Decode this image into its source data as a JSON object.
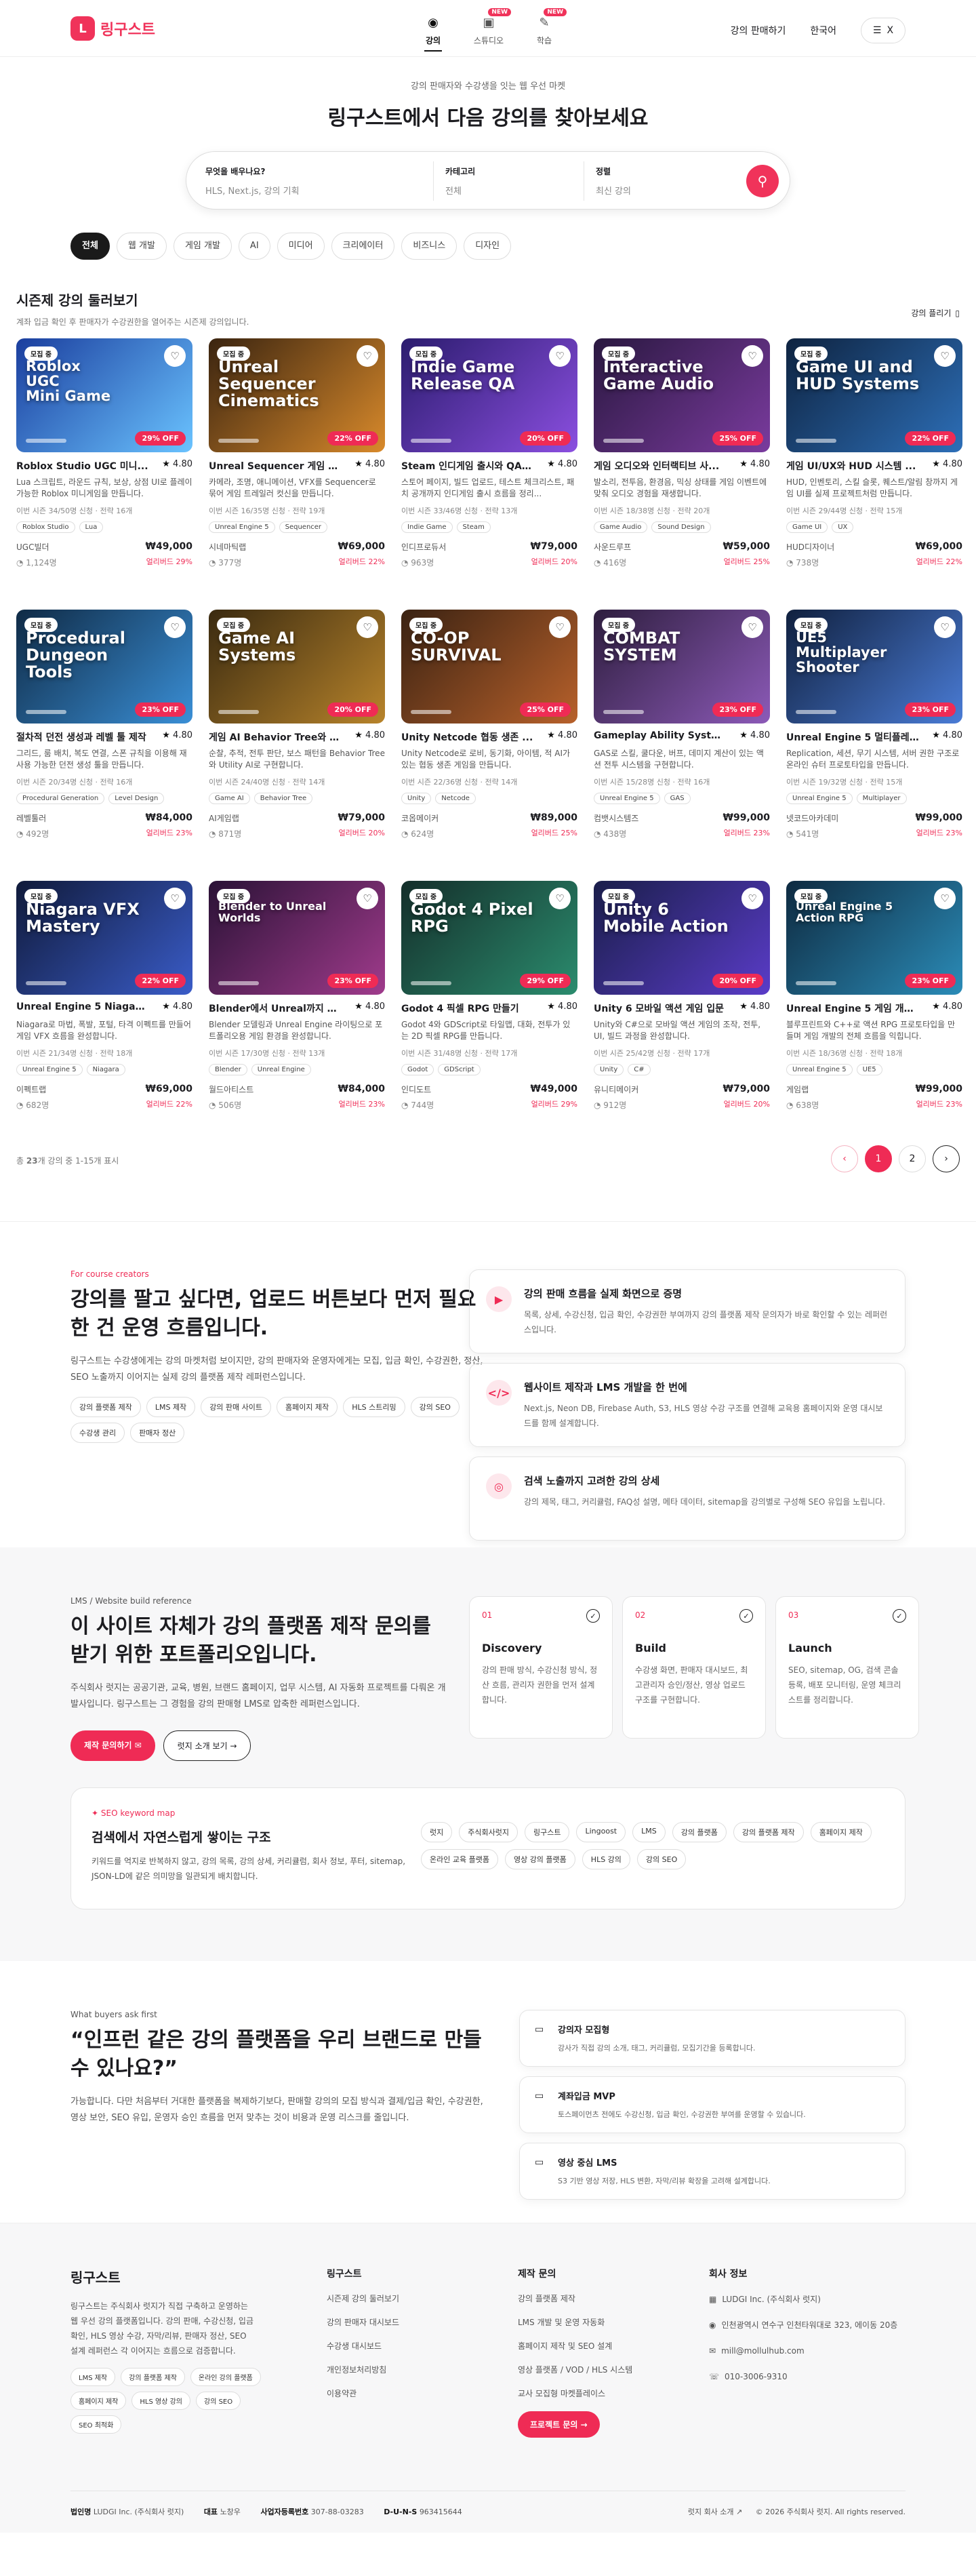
{
  "header": {
    "logo_mark": "L",
    "logo_text": "링구스트",
    "nav": [
      {
        "label": "강의",
        "icon": "play-circle-icon",
        "glyph": "▶",
        "badge": ""
      },
      {
        "label": "스튜디오",
        "icon": "studio-icon",
        "glyph": "◫",
        "badge": "NEW"
      },
      {
        "label": "학습",
        "icon": "learn-icon",
        "glyph": "✎",
        "badge": "NEW"
      }
    ],
    "sell_link": "강의 판매하기",
    "language": "한국어",
    "menu_icon": "☰",
    "menu_x": "X"
  },
  "hero": {
    "subtitle": "강의 판매자와 수강생을 잇는 웹 우선 마켓",
    "title": "링구스트에서 다음 강의를 찾아보세요",
    "search": {
      "q_label": "무엇을 배우나요?",
      "q_placeholder": "HLS, Next.js, 강의 기획",
      "cat_label": "카테고리",
      "cat_value": "전체",
      "sort_label": "정렬",
      "sort_value": "최신 강의"
    }
  },
  "categories": [
    "전체",
    "웹 개발",
    "게임 개발",
    "AI",
    "미디어",
    "크리에이터",
    "비즈니스",
    "디자인"
  ],
  "list": {
    "title": "시즌제 강의 둘러보기",
    "subtitle": "계좌 입금 확인 후 판매자가 수강권한을 열어주는 시즌제 강의입니다.",
    "toggle": "강의 플리기"
  },
  "courses": [
    {
      "thumb": "Roblox\nUGC\nMini Game",
      "colors": [
        "#1b3e9e",
        "#6ac3ff"
      ],
      "open": "모집 중",
      "off": "29% OFF",
      "title": "Roblox Studio UGC 미니...",
      "rating": "4.80",
      "desc": "Lua 스크립트, 라운드 규칙, 보상, 상점 UI로 플레이 가능한 Roblox 미니게임을 만듭니다.",
      "meta": "이번 시즌 34/50명 신청 · 전략 16개",
      "tags": [
        "Roblox Studio",
        "Lua"
      ],
      "author": "UGC빌더",
      "count": "1,124명",
      "price": "₩49,000",
      "early": "얼리버드 29%"
    },
    {
      "thumb": "Unreal Sequencer\nCinematics",
      "colors": [
        "#3a2410",
        "#d98a2b"
      ],
      "open": "모집 중",
      "off": "22% OFF",
      "title": "Unreal Sequencer 게임 시...",
      "rating": "4.80",
      "desc": "카메라, 조명, 애니메이션, VFX를 Sequencer로 묶어 게임 트레일러 컷신을 만듭니다.",
      "meta": "이번 시즌 16/35명 신청 · 전략 19개",
      "tags": [
        "Unreal Engine 5",
        "Sequencer"
      ],
      "author": "시네마틱랩",
      "count": "377명",
      "price": "₩69,000",
      "early": "얼리버드 22%"
    },
    {
      "thumb": "Indie Game\nRelease QA",
      "colors": [
        "#2b1c6e",
        "#8b4fe0"
      ],
      "open": "모집 중",
      "off": "20% OFF",
      "title": "Steam 인디게임 출시와 QA ...",
      "rating": "4.80",
      "desc": "스토어 페이지, 빌드 업로드, 테스트 체크리스트, 패치 공개까지 인디게임 출시 흐름을 정리...",
      "meta": "이번 시즌 33/46명 신청 · 전략 13개",
      "tags": [
        "Indie Game",
        "Steam"
      ],
      "author": "인디프로듀서",
      "count": "963명",
      "price": "₩79,000",
      "early": "얼리버드 20%"
    },
    {
      "thumb": "Interactive\nGame Audio",
      "colors": [
        "#2a1840",
        "#7a3b9e"
      ],
      "open": "모집 중",
      "off": "25% OFF",
      "title": "게임 오디오와 인터랙티브 사...",
      "rating": "4.80",
      "desc": "발소리, 전투음, 환경음, 믹싱 상태를 게임 이벤트에 맞춰 오디오 경험을 재생합니다.",
      "meta": "이번 시즌 18/38명 신청 · 전략 20개",
      "tags": [
        "Game Audio",
        "Sound Design"
      ],
      "author": "사운드루프",
      "count": "416명",
      "price": "₩59,000",
      "early": "얼리버드 25%"
    },
    {
      "thumb": "Game UI and\nHUD Systems",
      "colors": [
        "#0e2340",
        "#2d6fb8"
      ],
      "open": "모집 중",
      "off": "22% OFF",
      "title": "게임 UI/UX와 HUD 시스템 ...",
      "rating": "4.80",
      "desc": "HUD, 인벤토리, 스킬 슬롯, 퀘스트/알림 창까지 게임 UI를 실제 프로젝트처럼 만듭니다.",
      "meta": "이번 시즌 29/44명 신청 · 전략 15개",
      "tags": [
        "Game UI",
        "UX"
      ],
      "author": "HUD디자이너",
      "count": "738명",
      "price": "₩69,000",
      "early": "얼리버드 22%"
    },
    {
      "thumb": "Procedural\nDungeon Tools",
      "colors": [
        "#0f2a45",
        "#3a8fd6"
      ],
      "open": "모집 중",
      "off": "23% OFF",
      "title": "절차적 던전 생성과 레벨 툴 제작",
      "rating": "4.80",
      "desc": "그리드, 룸 배치, 복도 연결, 스폰 규칙을 이용해 재사용 가능한 던전 생성 툴을 만듭니다.",
      "meta": "이번 시즌 20/34명 신청 · 전략 16개",
      "tags": [
        "Procedural Generation",
        "Level Design"
      ],
      "author": "레벨툴러",
      "count": "492명",
      "price": "₩84,000",
      "early": "얼리버드 23%"
    },
    {
      "thumb": "Game AI\nSystems",
      "colors": [
        "#3a2a10",
        "#b8842b"
      ],
      "open": "모집 중",
      "off": "20% OFF",
      "title": "게임 AI Behavior Tree와 U...",
      "rating": "4.80",
      "desc": "순찰, 추적, 전투 판단, 보스 패턴을 Behavior Tree와 Utility AI로 구현합니다.",
      "meta": "이번 시즌 24/40명 신청 · 전략 14개",
      "tags": [
        "Game AI",
        "Behavior Tree"
      ],
      "author": "AI게임랩",
      "count": "871명",
      "price": "₩79,000",
      "early": "얼리버드 20%"
    },
    {
      "thumb": "CO-OP\nSURVIVAL",
      "colors": [
        "#3a2212",
        "#b8612b"
      ],
      "open": "모집 중",
      "off": "25% OFF",
      "title": "Unity Netcode 협동 생존 ...",
      "rating": "4.80",
      "desc": "Unity Netcode로 로비, 동기화, 아이템, 적 AI가 있는 협동 생존 게임을 만듭니다.",
      "meta": "이번 시즌 22/36명 신청 · 전략 14개",
      "tags": [
        "Unity",
        "Netcode"
      ],
      "author": "코옵메이커",
      "count": "624명",
      "price": "₩89,000",
      "early": "얼리버드 25%"
    },
    {
      "thumb": "COMBAT\nSYSTEM",
      "colors": [
        "#2e1e3e",
        "#8c5ab8"
      ],
      "open": "모집 중",
      "off": "23% OFF",
      "title": "Gameplay Ability Syste...",
      "rating": "4.80",
      "desc": "GAS로 스킬, 쿨다운, 버프, 데미지 계산이 있는 액션 전투 시스템을 구현합니다.",
      "meta": "이번 시즌 15/28명 신청 · 전략 16개",
      "tags": [
        "Unreal Engine 5",
        "GAS"
      ],
      "author": "컴뱃시스템즈",
      "count": "438명",
      "price": "₩99,000",
      "early": "얼리버드 23%"
    },
    {
      "thumb": "UE5\nMultiplayer\nShooter",
      "colors": [
        "#10203e",
        "#4a7cd6"
      ],
      "open": "모집 중",
      "off": "23% OFF",
      "title": "Unreal Engine 5 멀티플레...",
      "rating": "4.80",
      "desc": "Replication, 세션, 무기 시스템, 서버 권한 구조로 온라인 슈터 프로토타입을 만듭니다.",
      "meta": "이번 시즌 19/32명 신청 · 전략 15개",
      "tags": [
        "Unreal Engine 5",
        "Multiplayer"
      ],
      "author": "넷코드아카데미",
      "count": "541명",
      "price": "₩99,000",
      "early": "얼리버드 23%"
    },
    {
      "thumb": "Niagara VFX Mastery",
      "colors": [
        "#101a3a",
        "#3a5cc8"
      ],
      "open": "모집 중",
      "off": "22% OFF",
      "title": "Unreal Engine 5 Niagara...",
      "rating": "4.80",
      "desc": "Niagara로 마법, 폭발, 포털, 타격 이펙트를 만들어 게임 VFX 흐름을 완성합니다.",
      "meta": "이번 시즌 21/34명 신청 · 전략 18개",
      "tags": [
        "Unreal Engine 5",
        "Niagara"
      ],
      "author": "이펙트랩",
      "count": "682명",
      "price": "₩69,000",
      "early": "얼리버드 22%"
    },
    {
      "thumb": "Blender to Unreal Worlds",
      "colors": [
        "#2a1236",
        "#a03b8c"
      ],
      "open": "모집 중",
      "off": "23% OFF",
      "title": "Blender에서 Unreal까지 게...",
      "rating": "4.80",
      "desc": "Blender 모델링과 Unreal Engine 라이팅으로 포트폴리오용 게임 환경을 완성합니다.",
      "meta": "이번 시즌 17/30명 신청 · 전략 13개",
      "tags": [
        "Blender",
        "Unreal Engine"
      ],
      "author": "월드아티스트",
      "count": "506명",
      "price": "₩84,000",
      "early": "얼리버드 23%"
    },
    {
      "thumb": "Godot 4 Pixel RPG",
      "colors": [
        "#142e2a",
        "#2b8c6e"
      ],
      "open": "모집 중",
      "off": "29% OFF",
      "title": "Godot 4 픽셀 RPG 만들기",
      "rating": "4.80",
      "desc": "Godot 4와 GDScript로 타일맵, 대화, 전투가 있는 2D 픽셀 RPG를 만듭니다.",
      "meta": "이번 시즌 31/48명 신청 · 전략 17개",
      "tags": [
        "Godot",
        "GDScript"
      ],
      "author": "인디도트",
      "count": "744명",
      "price": "₩49,000",
      "early": "얼리버드 29%"
    },
    {
      "thumb": "Unity 6 Mobile Action",
      "colors": [
        "#1a1e4a",
        "#5a3cc8"
      ],
      "open": "모집 중",
      "off": "20% OFF",
      "title": "Unity 6 모바일 액션 게임 입문",
      "rating": "4.80",
      "desc": "Unity와 C#으로 모바일 액션 게임의 조작, 전투, UI, 빌드 과정을 완성합니다.",
      "meta": "이번 시즌 25/42명 신청 · 전략 17개",
      "tags": [
        "Unity",
        "C#"
      ],
      "author": "유니티메이커",
      "count": "912명",
      "price": "₩79,000",
      "early": "얼리버드 20%"
    },
    {
      "thumb": "Unreal Engine 5 Action RPG",
      "colors": [
        "#0e2a40",
        "#2b8cb8"
      ],
      "open": "모집 중",
      "off": "23% OFF",
      "title": "Unreal Engine 5 게임 개발...",
      "rating": "4.80",
      "desc": "블루프린트와 C++로 액션 RPG 프로토타입을 만들며 게임 개발의 전체 흐름을 익힙니다.",
      "meta": "이번 시즌 18/36명 신청 · 전략 18개",
      "tags": [
        "Unreal Engine 5",
        "UE5"
      ],
      "author": "게임랩",
      "count": "638명",
      "price": "₩99,000",
      "early": "얼리버드 23%"
    }
  ],
  "pagination": {
    "total_prefix": "총 ",
    "total_count": "23",
    "total_suffix": "개 강의 중 1-15개 표시",
    "prev": "‹",
    "pages": [
      "1",
      "2"
    ],
    "next": "›"
  },
  "creators": {
    "eyebrow": "For course creators",
    "title": "강의를 팔고 싶다면, 업로드 버튼보다 먼저 필요한 건 운영 흐름입니다.",
    "desc": "링구스트는 수강생에게는 강의 마켓처럼 보이지만, 강의 판매자와 운영자에게는 모집, 입금 확인, 수강권한, 정산, SEO 노출까지 이어지는 실제 강의 플랫폼 제작 레퍼런스입니다.",
    "chips": [
      "강의 플랫폼 제작",
      "LMS 제작",
      "강의 판매 사이트",
      "홈페이지 제작",
      "HLS 스트리밍",
      "강의 SEO",
      "수강생 관리",
      "판매자 정산"
    ],
    "features": [
      {
        "icon": "video-play-icon",
        "glyph": "▶",
        "title": "강의 판매 흐름을 실제 화면으로 증명",
        "desc": "목록, 상세, 수강신청, 입금 확인, 수강권한 부여까지 강의 플랫폼 제작 문의자가 바로 확인할 수 있는 레퍼런스입니다."
      },
      {
        "icon": "code-icon",
        "glyph": "</>",
        "title": "웹사이트 제작과 LMS 개발을 한 번에",
        "desc": "Next.js, Neon DB, Firebase Auth, S3, HLS 영상 수강 구조를 연결해 교육용 홈페이지와 운영 대시보드를 함께 설계합니다."
      },
      {
        "icon": "target-icon",
        "glyph": "◎",
        "title": "검색 노출까지 고려한 강의 상세",
        "desc": "강의 제목, 태그, 커리큘럼, FAQ성 설명, 메타 데이터, sitemap을 강의별로 구성해 SEO 유입을 노립니다."
      }
    ]
  },
  "lms": {
    "eyebrow": "LMS / Website build reference",
    "title": "이 사이트 자체가 강의 플랫폼 제작 문의를 받기 위한 포트폴리오입니다.",
    "desc": "주식회사 럿지는 공공기관, 교육, 병원, 브랜드 홈페이지, 업무 시스템, AI 자동화 프로젝트를 다뤄온 개발사입니다. 링구스트는 그 경험을 강의 판매형 LMS로 압축한 레퍼런스입니다.",
    "primary_btn": "제작 문의하기",
    "secondary_btn": "럿지 소개 보기 →",
    "steps": [
      {
        "num": "01",
        "title": "Discovery",
        "desc": "강의 판매 방식, 수강신청 방식, 정산 흐름, 관리자 권한을 먼저 설계합니다."
      },
      {
        "num": "02",
        "title": "Build",
        "desc": "수강생 화면, 판매자 대시보드, 최고관리자 승인/정산, 영상 업로드 구조를 구현합니다."
      },
      {
        "num": "03",
        "title": "Launch",
        "desc": "SEO, sitemap, OG, 검색 콘솔 등록, 배포 모니터링, 운영 체크리스트를 정리합니다."
      }
    ],
    "seo_eyebrow": "SEO keyword map",
    "seo_title": "검색에서 자연스럽게 쌓이는 구조",
    "seo_desc": "키워드를 억지로 반복하지 않고, 강의 목록, 강의 상세, 커리큘럼, 회사 정보, 푸터, sitemap, JSON-LD에 같은 의미망을 일관되게 배치합니다.",
    "keywords": [
      "럿지",
      "주식회사럿지",
      "링구스트",
      "Lingoost",
      "LMS",
      "강의 플랫폼",
      "강의 플랫폼 제작",
      "홈페이지 제작",
      "온라인 교육 플랫폼",
      "영상 강의 플랫폼",
      "HLS 강의",
      "강의 SEO"
    ]
  },
  "faq": {
    "eyebrow": "What buyers ask first",
    "title": "“인프런 같은 강의 플랫폼을 우리 브랜드로 만들 수 있나요?”",
    "desc": "가능합니다. 다만 처음부터 거대한 플랫폼을 복제하기보다, 판매할 강의의 모집 방식과 결제/입금 확인, 수강권한, 영상 보안, SEO 유입, 운영자 승인 흐름을 먼저 맞추는 것이 비용과 운영 리스크를 줄입니다.",
    "items": [
      {
        "icon": "video-icon",
        "glyph": "▭",
        "title": "강의자 모집형",
        "desc": "강사가 직접 강의 소개, 태그, 커리큘럼, 모집기간을 등록합니다."
      },
      {
        "icon": "video-icon",
        "glyph": "▭",
        "title": "계좌입금 MVP",
        "desc": "토스페이먼츠 전에도 수강신청, 입금 확인, 수강권한 부여를 운영할 수 있습니다."
      },
      {
        "icon": "video-icon",
        "glyph": "▭",
        "title": "영상 중심 LMS",
        "desc": "S3 기반 영상 저장, HLS 변환, 자막/리뷰 확장을 고려해 설계합니다."
      }
    ]
  },
  "footer": {
    "brand": "링구스트",
    "brand_desc": "링구스트는 주식회사 럿지가 직접 구축하고 운영하는 웹 우선 강의 플랫폼입니다. 강의 판매, 수강신청, 입금 확인, HLS 영상 수강, 자막/리뷰, 판매자 정산, SEO 설계 레퍼런스 각 이어지는 흐름으로 검증합니다.",
    "chips": [
      "LMS 제작",
      "강의 플랫폼 제작",
      "온라인 강의 플랫폼",
      "홈페이지 제작",
      "HLS 영상 강의",
      "강의 SEO",
      "SEO 최적화"
    ],
    "col1_title": "링구스트",
    "col1": [
      "시즌제 강의 둘러보기",
      "강의 판매자 대시보드",
      "수강생 대시보드",
      "개인정보처리방침",
      "이용약관"
    ],
    "col2_title": "제작 문의",
    "col2": [
      "강의 플랫폼 제작",
      "LMS 개발 및 운영 자동화",
      "홈페이지 제작 및 SEO 설계",
      "영상 플랫폼 / VOD / HLS 시스템",
      "교사 모집형 마켓플레이스"
    ],
    "cta": "프로젝트 문의 →",
    "col3_title": "회사 정보",
    "company": "LUDGI Inc. (주식회사 럿지)",
    "address": "인천광역시 연수구 인천타워대로 323, 에이동 20층",
    "email": "mill@mollulhub.com",
    "phone": "010-3006-9310",
    "bottom": {
      "corp_label": "법인명",
      "corp": "LUDGI Inc. (주식회사 럿지)",
      "ceo_label": "대표",
      "ceo": "노창우",
      "biz_label": "사업자등록번호",
      "biz": "307-88-03283",
      "duns_label": "D-U-N-S",
      "duns": "963415644",
      "about_link": "럿지 회사 소개 ↗",
      "copyright": "© 2026 주식회사 럿지. All rights reserved."
    }
  }
}
